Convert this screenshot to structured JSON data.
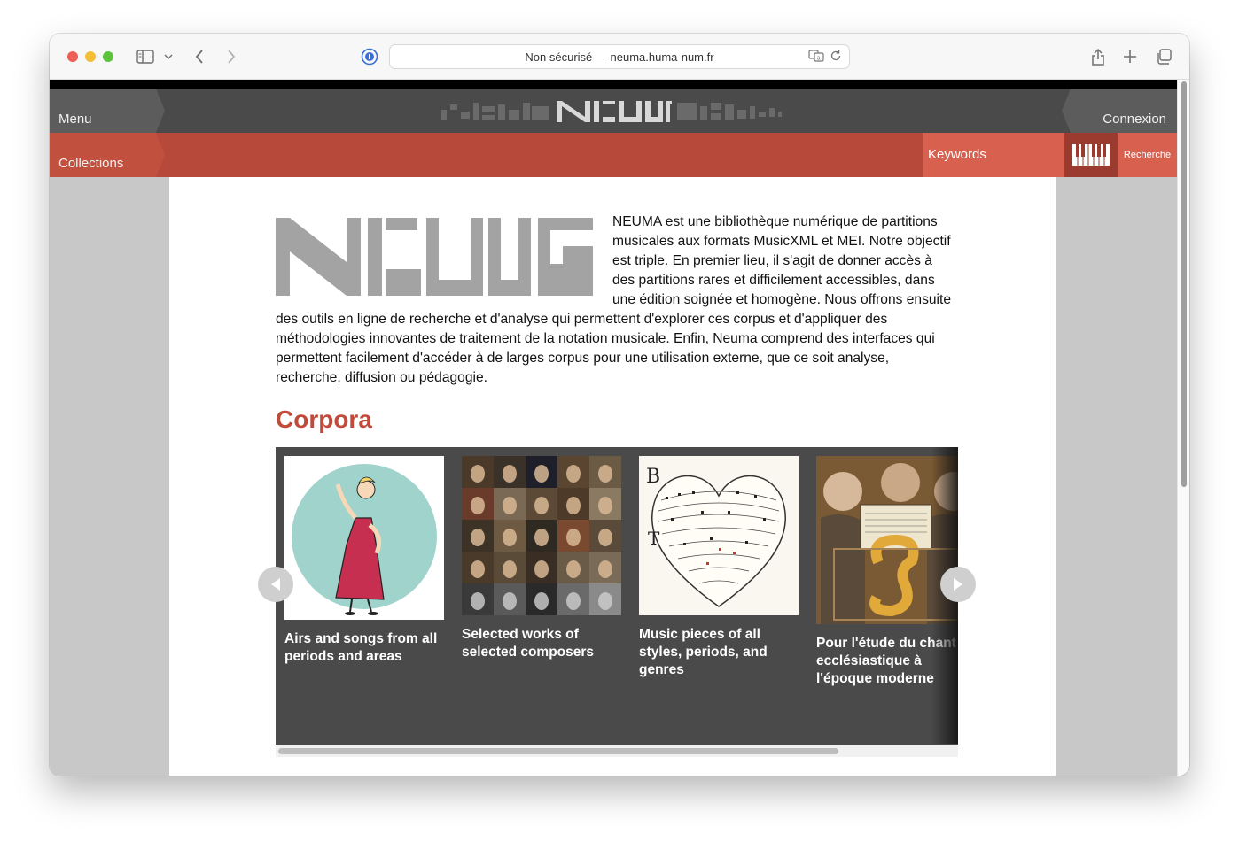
{
  "browser": {
    "address": "Non sécurisé — neuma.huma-num.fr"
  },
  "nav": {
    "menu_label": "Menu",
    "connexion_label": "Connexion",
    "collections_label": "Collections",
    "keywords_label": "Keywords",
    "recherche_label": "Recherche"
  },
  "intro": {
    "text": "NEUMA est une bibliothèque numérique de partitions musicales aux formats MusicXML et MEI. Notre objectif est triple. En premier lieu, il s'agit de donner accès à des partitions rares et difficilement accessibles, dans une édition soignée et homogène. Nous offrons ensuite des outils en ligne de recherche et d'analyse qui permettent d'explorer ces corpus et d'appliquer des méthodologies innovantes de traitement de la notation musicale. Enfin, Neuma comprend des interfaces qui permettent facilement d'accéder à de larges corpus pour une utilisation externe, que ce soit analyse, recherche, diffusion ou pédagogie."
  },
  "corpora": {
    "title": "Corpora",
    "cards": [
      {
        "title": "Airs and songs from all periods and areas",
        "image": "singer-illustration"
      },
      {
        "title": "Selected works of selected composers",
        "image": "composer-portraits-grid"
      },
      {
        "title": "Music pieces of all styles, periods, and genres",
        "image": "heart-shaped-score"
      },
      {
        "title": "Pour l'étude du chant ecclésiastique à l'époque moderne",
        "image": "choir-manuscript-painting"
      }
    ]
  },
  "colors": {
    "accent_red": "#b6493a",
    "title_red": "#c24a3a",
    "dark_bar": "#4a4a4a"
  }
}
